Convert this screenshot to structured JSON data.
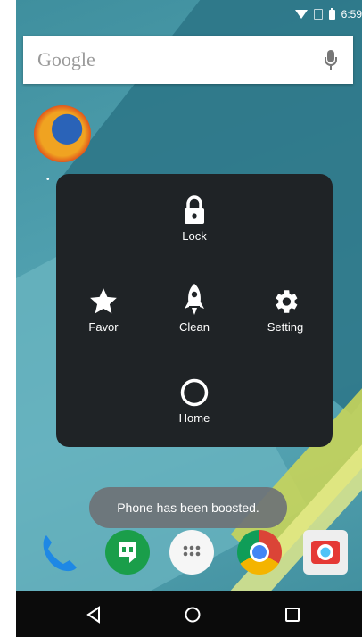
{
  "status_bar": {
    "time": "6:59",
    "icons": [
      "wifi-icon",
      "sim-icon",
      "battery-icon"
    ]
  },
  "search": {
    "label": "Google",
    "icon": "mic-icon"
  },
  "home_screen": {
    "app_icons": [
      "firefox-icon"
    ]
  },
  "assistive_menu": {
    "items": [
      {
        "label": "Lock",
        "icon": "lock-icon"
      },
      {
        "label": "Favor",
        "icon": "star-icon"
      },
      {
        "label": "Clean",
        "icon": "rocket-icon"
      },
      {
        "label": "Setting",
        "icon": "gear-icon"
      },
      {
        "label": "Home",
        "icon": "circle-icon"
      }
    ]
  },
  "toast": {
    "message": "Phone has been boosted."
  },
  "dock": {
    "apps": [
      "phone-icon",
      "hangouts-icon",
      "app-drawer-icon",
      "chrome-icon",
      "camera-icon"
    ]
  },
  "nav_bar": {
    "buttons": [
      "back-icon",
      "home-icon",
      "recents-icon"
    ]
  },
  "colors": {
    "menu_bg": "#1f2326",
    "toast_bg": "#6e7276",
    "wallpaper": "#4f9fae",
    "navbar": "#0b0b0b"
  }
}
